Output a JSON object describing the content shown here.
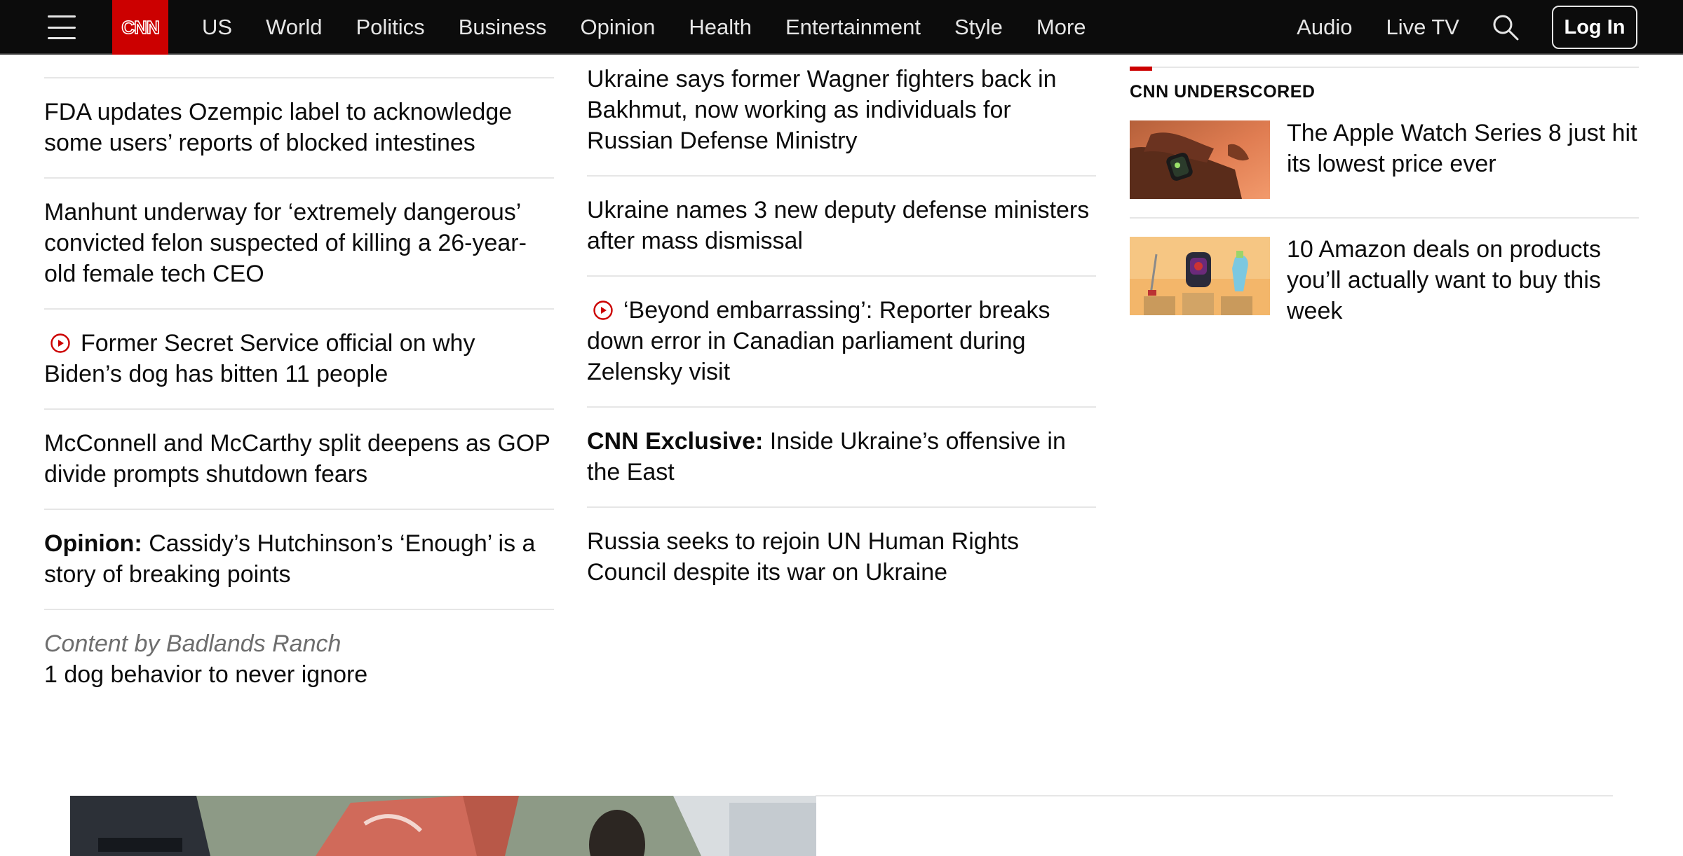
{
  "header": {
    "logo_text": "CNN",
    "nav": [
      "US",
      "World",
      "Politics",
      "Business",
      "Opinion",
      "Health",
      "Entertainment",
      "Style",
      "More"
    ],
    "audio": "Audio",
    "live_tv": "Live TV",
    "login": "Log In"
  },
  "column1": {
    "stories": [
      {
        "lead": "",
        "text": "FDA updates Ozempic label to acknowledge some users’ reports of blocked intestines",
        "video": false
      },
      {
        "lead": "",
        "text": "Manhunt underway for ‘extremely dangerous’ convicted felon suspected of killing a 26-year-old female tech CEO",
        "video": false
      },
      {
        "lead": "",
        "text": "Former Secret Service official on why Biden’s dog has bitten 11 people",
        "video": true
      },
      {
        "lead": "",
        "text": "McConnell and McCarthy split deepens as GOP divide prompts shutdown fears",
        "video": false
      },
      {
        "lead": "Opinion:",
        "text": " Cassidy’s Hutchinson’s ‘Enough’ is a story of breaking points",
        "video": false
      }
    ],
    "sponsor": {
      "label": "Content by Badlands Ranch",
      "title": "1 dog behavior to never ignore"
    }
  },
  "column2": {
    "stories": [
      {
        "lead": "",
        "text": "Ukraine says former Wagner fighters back in Bakhmut, now working as individuals for Russian Defense Ministry",
        "video": false
      },
      {
        "lead": "",
        "text": "Ukraine names 3 new deputy defense ministers after mass dismissal",
        "video": false
      },
      {
        "lead": "",
        "text": "‘Beyond embarrassing’: Reporter breaks down error in Canadian parliament during Zelensky visit",
        "video": true
      },
      {
        "lead": "CNN Exclusive:",
        "text": " Inside Ukraine’s offensive in the East",
        "video": false
      },
      {
        "lead": "",
        "text": "Russia seeks to rejoin UN Human Rights Council despite its war on Ukraine",
        "video": false
      }
    ]
  },
  "underscored": {
    "heading": "CNN UNDERSCORED",
    "items": [
      {
        "title": "The Apple Watch Series 8 just hit its lowest price ever"
      },
      {
        "title": "10 Amazon deals on products you’ll actually want to buy this week"
      }
    ]
  },
  "colors": {
    "brand_red": "#cc0000",
    "header_bg": "#0c0c0c",
    "divider": "#e6e6e6",
    "sponsor_gray": "#6e6e6e"
  },
  "icons": {
    "menu": "hamburger-menu-icon",
    "search": "search-icon",
    "video": "play-circle-icon"
  }
}
